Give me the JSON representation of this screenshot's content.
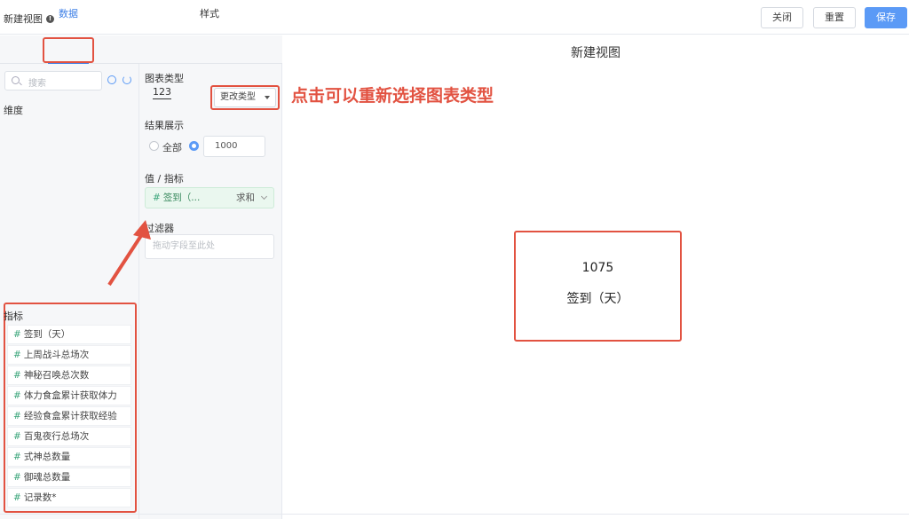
{
  "window": {
    "title": "新建视图"
  },
  "buttons": {
    "close": "关闭",
    "reset": "重置",
    "save": "保存"
  },
  "tabs": {
    "data": "数据",
    "style": "样式"
  },
  "search": {
    "placeholder": "搜索"
  },
  "dimension_label": "维度",
  "metric_label": "指标",
  "metrics": [
    "签到（天）",
    "上周战斗总场次",
    "神秘召唤总次数",
    "体力食盒累计获取体力",
    "经验食盒累计获取经验",
    "百鬼夜行总场次",
    "式神总数量",
    "御魂总数量",
    "记录数*"
  ],
  "config": {
    "chart_type_label": "图表类型",
    "chart_type_value": "123",
    "change_type_button": "更改类型",
    "result_label": "结果展示",
    "option_all": "全部",
    "limit_value": "1000",
    "value_label": "值 / 指标",
    "value_field": "签到（...",
    "value_agg": "求和",
    "filter_label": "过滤器",
    "filter_placeholder": "拖动字段至此处"
  },
  "main": {
    "view_title": "新建视图",
    "annotation": "点击可以重新选择图表类型",
    "kpi_value": "1075",
    "kpi_label": "签到（天）"
  },
  "colors": {
    "accent": "#3d7fe6",
    "annotation": "#e25241",
    "save": "#5b9af6"
  }
}
